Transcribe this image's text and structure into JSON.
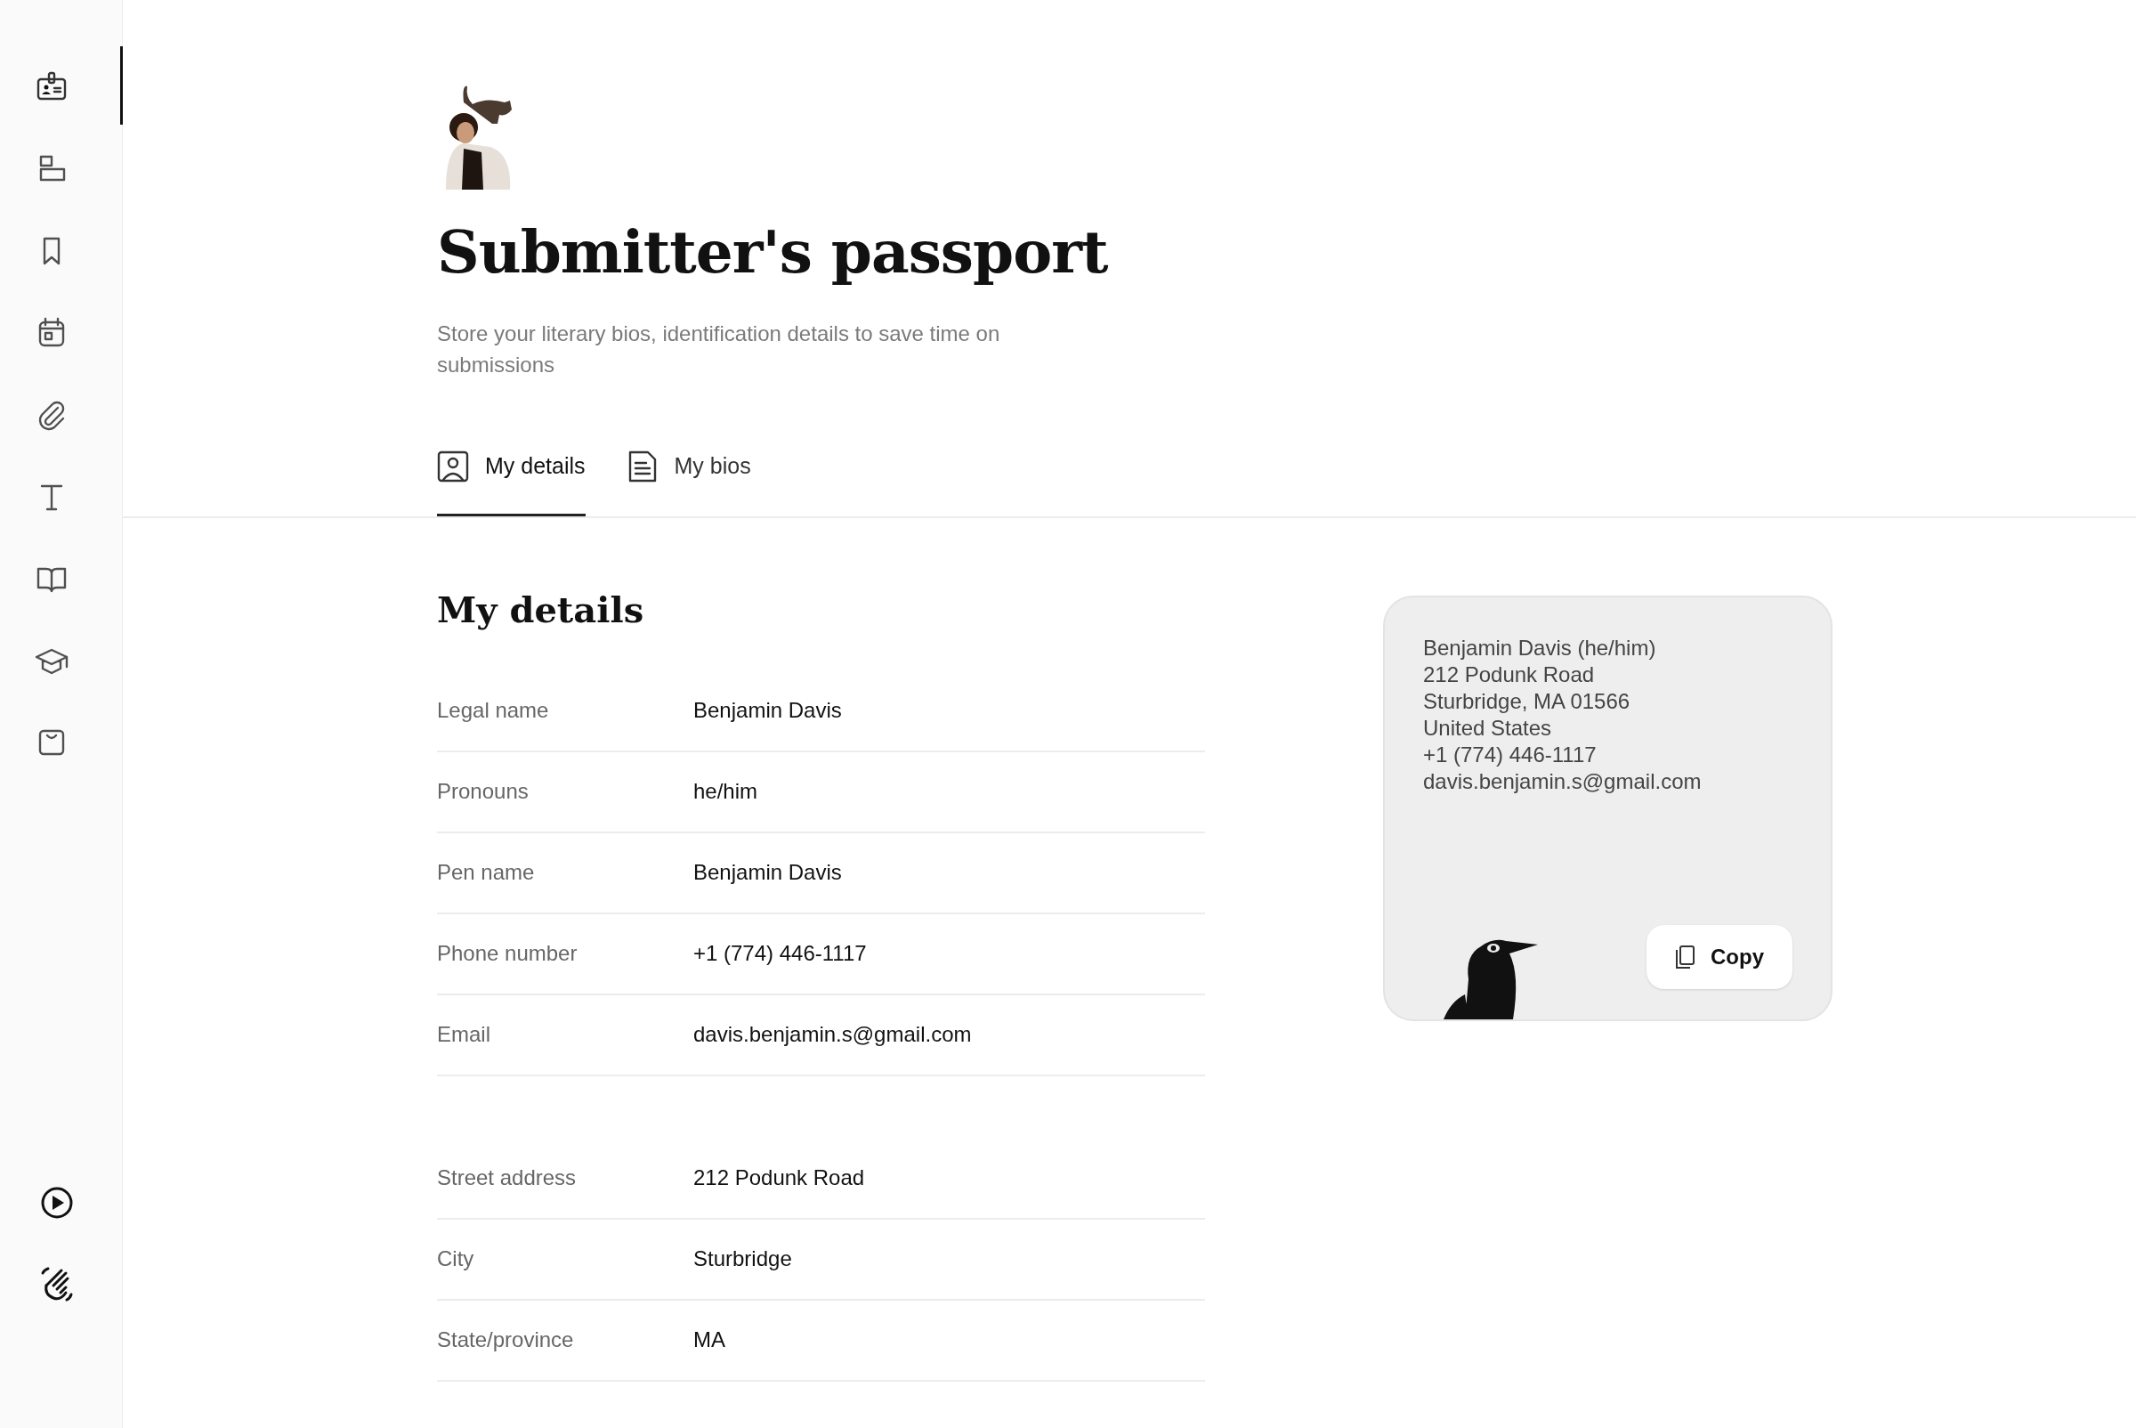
{
  "sidebar": {
    "items": [
      {
        "selected": true
      },
      {
        "selected": false
      },
      {
        "selected": false
      },
      {
        "selected": false
      },
      {
        "selected": false
      },
      {
        "selected": false
      },
      {
        "selected": false
      },
      {
        "selected": false
      },
      {
        "selected": false
      }
    ]
  },
  "header": {
    "title": "Submitter's passport",
    "subtitle": "Store your literary bios, identification details to save time on submissions"
  },
  "tabs": [
    {
      "label": "My details",
      "selected": true
    },
    {
      "label": "My bios",
      "selected": false
    }
  ],
  "details": {
    "heading": "My details",
    "sections": [
      {
        "rows": [
          {
            "label": "Legal name",
            "value": "Benjamin Davis"
          },
          {
            "label": "Pronouns",
            "value": "he/him"
          },
          {
            "label": "Pen name",
            "value": "Benjamin Davis"
          },
          {
            "label": "Phone number",
            "value": "+1 (774) 446-1117"
          },
          {
            "label": "Email",
            "value": "davis.benjamin.s@gmail.com"
          }
        ]
      },
      {
        "rows": [
          {
            "label": "Street address",
            "value": "212 Podunk Road"
          },
          {
            "label": "City",
            "value": "Sturbridge"
          },
          {
            "label": "State/province",
            "value": "MA"
          }
        ]
      }
    ]
  },
  "card": {
    "lines": [
      "Benjamin Davis (he/him)",
      "212 Podunk Road",
      "Sturbridge, MA 01566",
      "United States",
      "+1 (774) 446-1117",
      "davis.benjamin.s@gmail.com"
    ],
    "copy_button": "Copy"
  }
}
